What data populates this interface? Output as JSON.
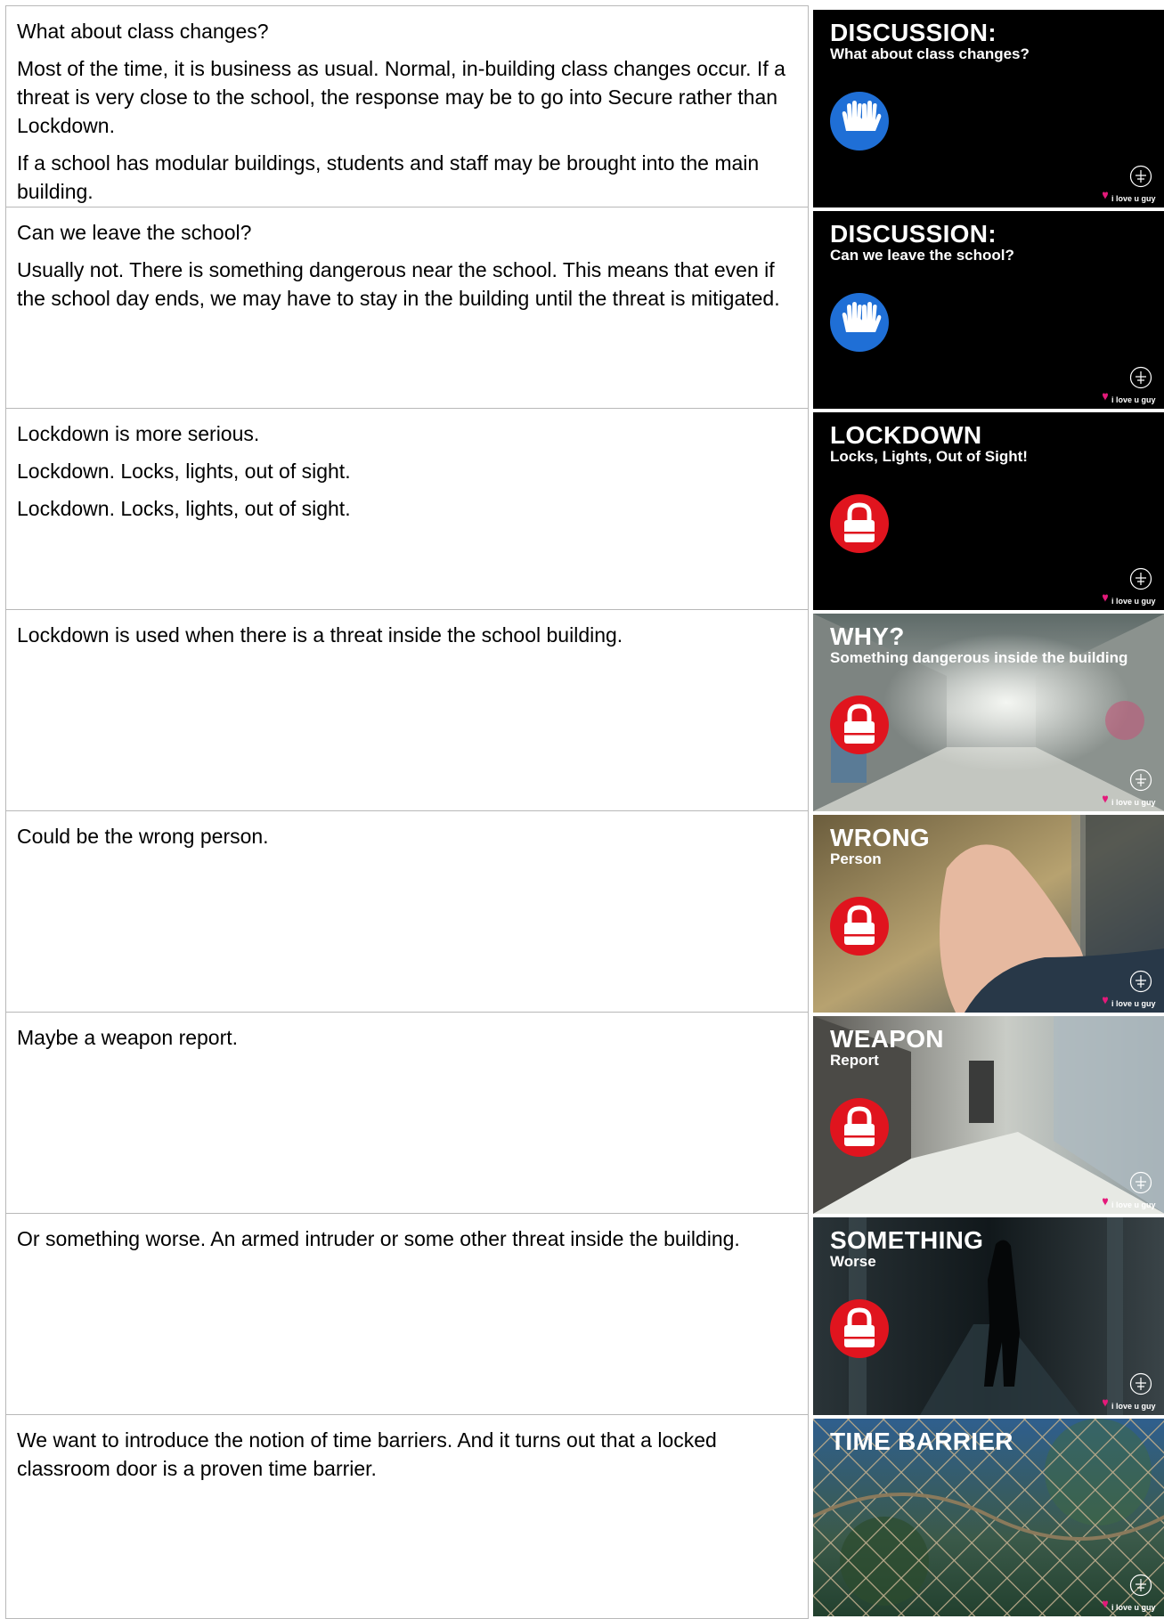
{
  "rows": [
    {
      "paragraphs": [
        "What about class changes?",
        "Most of the time, it is business as usual. Normal, in-building class changes occur. If a threat is very close to the school, the response may be to go into Secure rather than Lockdown.",
        "If a school has modular buildings, students and staff may be brought into the main building."
      ],
      "slide": {
        "title": "DISCUSSION:",
        "subtitle": "What about class changes?",
        "icon": "hands-icon",
        "badge_color": "#1f6fd6",
        "background": "black"
      }
    },
    {
      "paragraphs": [
        "Can we leave the school?",
        "Usually not. There is something dangerous near the school. This means that even if the school day ends, we may have to stay in the building until the threat is mitigated."
      ],
      "slide": {
        "title": "DISCUSSION:",
        "subtitle": "Can we leave the school?",
        "icon": "hands-icon",
        "badge_color": "#1f6fd6",
        "background": "black"
      }
    },
    {
      "paragraphs": [
        "Lockdown is more serious.",
        "Lockdown. Locks, lights, out of sight.",
        "Lockdown. Locks, lights, out of sight."
      ],
      "slide": {
        "title": "LOCKDOWN",
        "subtitle": "Locks, Lights, Out of Sight!",
        "icon": "padlock-icon",
        "badge_color": "#e0141e",
        "background": "black"
      }
    },
    {
      "paragraphs": [
        "Lockdown is used when there is a threat inside the school building."
      ],
      "slide": {
        "title": "WHY?",
        "subtitle": "Something dangerous inside the building",
        "icon": "padlock-icon",
        "badge_color": "#e0141e",
        "background": "hallway-photo"
      }
    },
    {
      "paragraphs": [
        "Could be the wrong person."
      ],
      "slide": {
        "title": "WRONG",
        "subtitle": "Person",
        "icon": "padlock-icon",
        "badge_color": "#e0141e",
        "background": "hand-photo"
      }
    },
    {
      "paragraphs": [
        "Maybe a weapon report."
      ],
      "slide": {
        "title": "WEAPON",
        "subtitle": "Report",
        "icon": "padlock-icon",
        "badge_color": "#e0141e",
        "background": "lockers-photo"
      }
    },
    {
      "paragraphs": [
        "Or something worse. An armed intruder or some other threat inside the building."
      ],
      "slide": {
        "title": "SOMETHING",
        "subtitle": "Worse",
        "icon": "padlock-icon",
        "badge_color": "#e0141e",
        "background": "dark-hallway-photo"
      }
    },
    {
      "paragraphs": [
        "We want to introduce the notion of time barriers. And it turns out that a locked classroom door is a proven time barrier."
      ],
      "slide": {
        "title": "TIME BARRIER",
        "subtitle": "",
        "icon": "",
        "badge_color": "",
        "background": "fence-photo"
      }
    }
  ],
  "logo_text": "i love u guys"
}
